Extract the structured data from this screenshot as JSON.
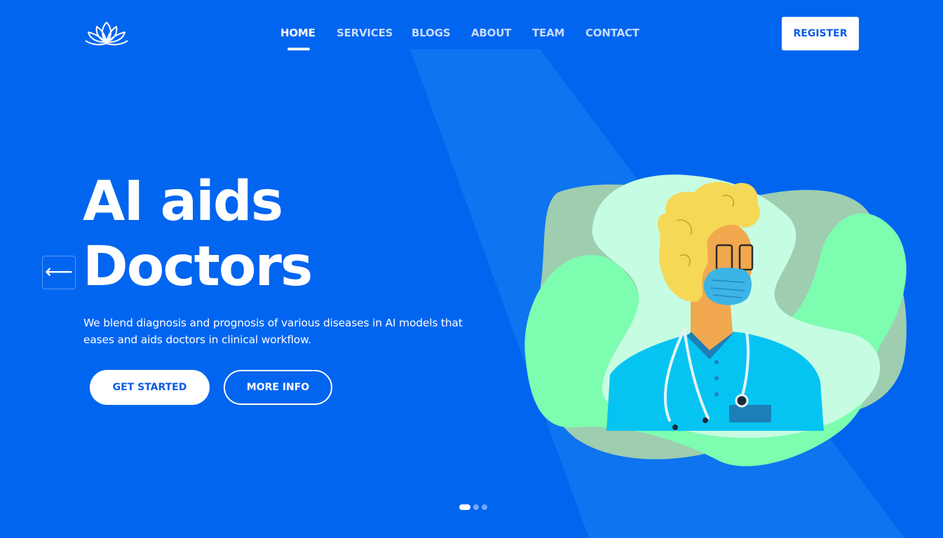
{
  "nav": {
    "items": [
      {
        "label": "HOME",
        "active": true
      },
      {
        "label": "SERVICES",
        "active": false
      },
      {
        "label": "BLOGS",
        "active": false
      },
      {
        "label": "ABOUT",
        "active": false
      },
      {
        "label": "TEAM",
        "active": false
      },
      {
        "label": "CONTACT",
        "active": false
      }
    ],
    "register_label": "REGISTER"
  },
  "hero": {
    "title_line1": "AI aids",
    "title_line2": "Doctors",
    "description": "We blend diagnosis and prognosis of various diseases in AI models that eases and aids doctors in clinical workflow.",
    "primary_button": "GET STARTED",
    "secondary_button": "MORE INFO"
  },
  "carousel": {
    "prev_icon": "arrow-left-icon",
    "next_icon": "arrow-right-icon",
    "prev_glyph": "⟵",
    "next_glyph": "⟶",
    "slide_count": 3,
    "active_slide": 1
  },
  "colors": {
    "background": "#0265f0",
    "accent": "#0a5ae6",
    "blob_green": "#7dfdb0",
    "blob_mint": "#c6fce2"
  }
}
